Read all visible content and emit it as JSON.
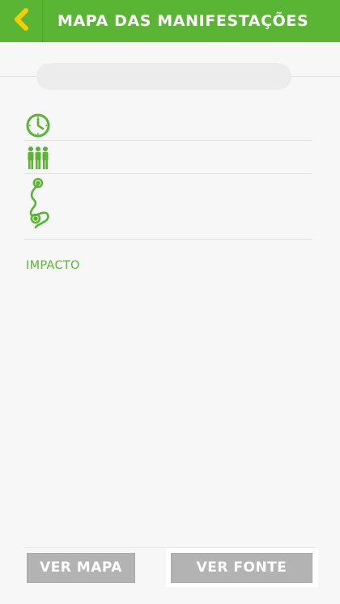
{
  "header": {
    "title": "MAPA DAS MANIFESTAÇÕES",
    "back_icon": "chevron-left-icon",
    "back_color": "#f5d000",
    "background": "#5bb534"
  },
  "event": {
    "title": "",
    "time": "",
    "people": "",
    "route": ""
  },
  "impact": {
    "label": "IMPACTO"
  },
  "buttons": {
    "map_label": "VER MAPA",
    "source_label": "VER FONTE"
  },
  "colors": {
    "accent": "#5bb534",
    "button_bg": "#b3b3b3"
  }
}
